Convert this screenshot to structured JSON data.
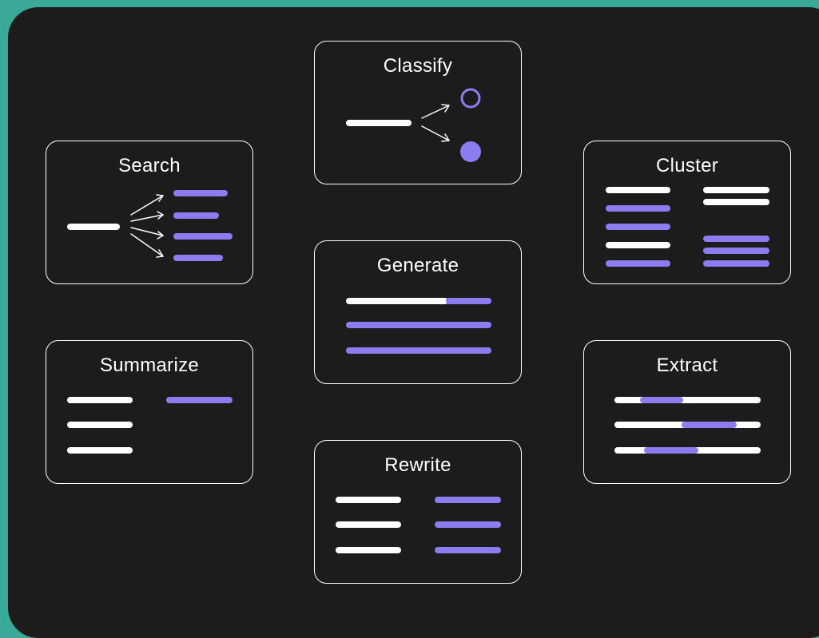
{
  "colors": {
    "background": "#3aa997",
    "panel": "#1c1c1c",
    "white": "#ffffff",
    "accent": "#8b7cf0"
  },
  "cards": {
    "classify": {
      "title": "Classify"
    },
    "search": {
      "title": "Search"
    },
    "cluster": {
      "title": "Cluster"
    },
    "generate": {
      "title": "Generate"
    },
    "summarize": {
      "title": "Summarize"
    },
    "extract": {
      "title": "Extract"
    },
    "rewrite": {
      "title": "Rewrite"
    }
  }
}
